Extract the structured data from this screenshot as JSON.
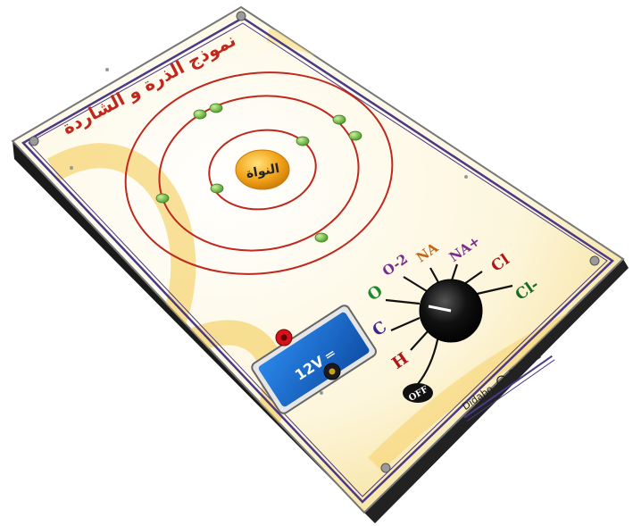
{
  "board": {
    "title": "نموذج الذرة و الشاردة",
    "nucleus_label": "النواة",
    "brand": "Didabo",
    "model": "DB 321"
  },
  "power": {
    "label": "12V ═"
  },
  "selector": {
    "positions": [
      {
        "label": "OFF",
        "color": "#111111"
      },
      {
        "label": "H",
        "color": "#b01818"
      },
      {
        "label": "C",
        "color": "#3a2a8a"
      },
      {
        "label": "O",
        "color": "#1f8a2a"
      },
      {
        "label": "O-2",
        "color": "#7a2a8a"
      },
      {
        "label": "NA",
        "color": "#c0671a"
      },
      {
        "label": "NA+",
        "color": "#7a2a8a"
      },
      {
        "label": "Cl",
        "color": "#b01818"
      },
      {
        "label": "Cl-",
        "color": "#1a6a2a"
      }
    ]
  },
  "colors": {
    "frame": "#4a3a86",
    "orbit": "#c0281e",
    "electron": "#79c04a",
    "nucleus": "#f2a31a",
    "knob": "#111111",
    "panel": "#1b6fd1"
  }
}
